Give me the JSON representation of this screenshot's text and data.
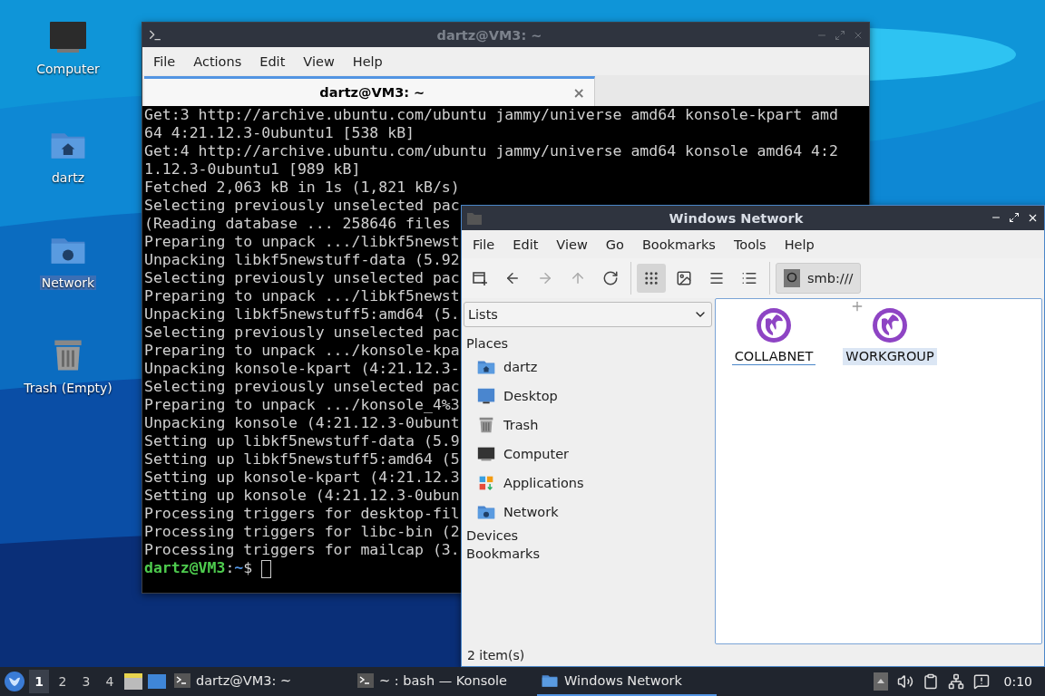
{
  "desktop_icons": [
    {
      "kind": "computer",
      "label": "Computer",
      "selected": false
    },
    {
      "kind": "home",
      "label": "dartz",
      "selected": false
    },
    {
      "kind": "network",
      "label": "Network",
      "selected": true
    },
    {
      "kind": "trash",
      "label": "Trash (Empty)",
      "selected": false
    }
  ],
  "terminal": {
    "title": "dartz@VM3: ~",
    "menu": [
      "File",
      "Actions",
      "Edit",
      "View",
      "Help"
    ],
    "tabs": [
      {
        "label": "dartz@VM3: ~",
        "selected": true,
        "close": "×"
      }
    ],
    "lines": [
      "Get:3 http://archive.ubuntu.com/ubuntu jammy/universe amd64 konsole-kpart amd",
      "64 4:21.12.3-0ubuntu1 [538 kB]",
      "Get:4 http://archive.ubuntu.com/ubuntu jammy/universe amd64 konsole amd64 4:2",
      "1.12.3-0ubuntu1 [989 kB]",
      "Fetched 2,063 kB in 1s (1,821 kB/s)",
      "Selecting previously unselected pac",
      "(Reading database ... 258646 files",
      "Preparing to unpack .../libkf5newst",
      "Unpacking libkf5newstuff-data (5.92",
      "Selecting previously unselected pac",
      "Preparing to unpack .../libkf5newst",
      "Unpacking libkf5newstuff5:amd64 (5.",
      "Selecting previously unselected pac",
      "Preparing to unpack .../konsole-kpa",
      "Unpacking konsole-kpart (4:21.12.3-",
      "Selecting previously unselected pac",
      "Preparing to unpack .../konsole_4%3",
      "Unpacking konsole (4:21.12.3-0ubunt",
      "Setting up libkf5newstuff-data (5.9",
      "Setting up libkf5newstuff5:amd64 (5",
      "Setting up konsole-kpart (4:21.12.3",
      "Setting up konsole (4:21.12.3-0ubun",
      "Processing triggers for desktop-fil",
      "Processing triggers for libc-bin (2",
      "Processing triggers for mailcap (3."
    ],
    "prompt": {
      "user_host": "dartz@VM3",
      "separator": ":",
      "path": "~",
      "symbol": "$"
    }
  },
  "file_manager": {
    "title": "Windows Network",
    "menu": [
      "File",
      "Edit",
      "View",
      "Go",
      "Bookmarks",
      "Tools",
      "Help"
    ],
    "nav": [
      {
        "kind": "new-tab",
        "disabled": false
      },
      {
        "kind": "back",
        "disabled": false
      },
      {
        "kind": "forward",
        "disabled": true
      },
      {
        "kind": "up",
        "disabled": true
      },
      {
        "kind": "reload",
        "disabled": false
      }
    ],
    "view_modes": [
      {
        "kind": "icons",
        "selected": true
      },
      {
        "kind": "thumbnails",
        "selected": false
      },
      {
        "kind": "compact",
        "selected": false
      },
      {
        "kind": "detailed",
        "selected": false
      }
    ],
    "location": "smb:///",
    "side_pane": {
      "dropdown": "Lists",
      "sections": [
        {
          "title": "Places",
          "items": [
            {
              "kind": "home",
              "label": "dartz"
            },
            {
              "kind": "desktop",
              "label": "Desktop"
            },
            {
              "kind": "trash",
              "label": "Trash"
            },
            {
              "kind": "computer",
              "label": "Computer"
            },
            {
              "kind": "applications",
              "label": "Applications"
            },
            {
              "kind": "network",
              "label": "Network"
            }
          ]
        },
        {
          "title": "Devices"
        },
        {
          "title": "Bookmarks"
        }
      ]
    },
    "items": [
      {
        "label": "COLLABNET",
        "selected": false,
        "focused": true
      },
      {
        "label": "WORKGROUP",
        "selected": true,
        "focused": false
      }
    ],
    "status": "2 item(s)"
  },
  "taskbar": {
    "workspaces": [
      {
        "label": "1",
        "selected": true
      },
      {
        "label": "2",
        "selected": false
      },
      {
        "label": "3",
        "selected": false
      },
      {
        "label": "4",
        "selected": false
      }
    ],
    "tasks": [
      {
        "kind": "terminal",
        "label": "dartz@VM3: ~",
        "active": false
      },
      {
        "kind": "terminal",
        "label": "~ : bash — Konsole",
        "active": false
      },
      {
        "kind": "folder",
        "label": "Windows Network",
        "active": true
      }
    ],
    "clock": "0:10"
  }
}
